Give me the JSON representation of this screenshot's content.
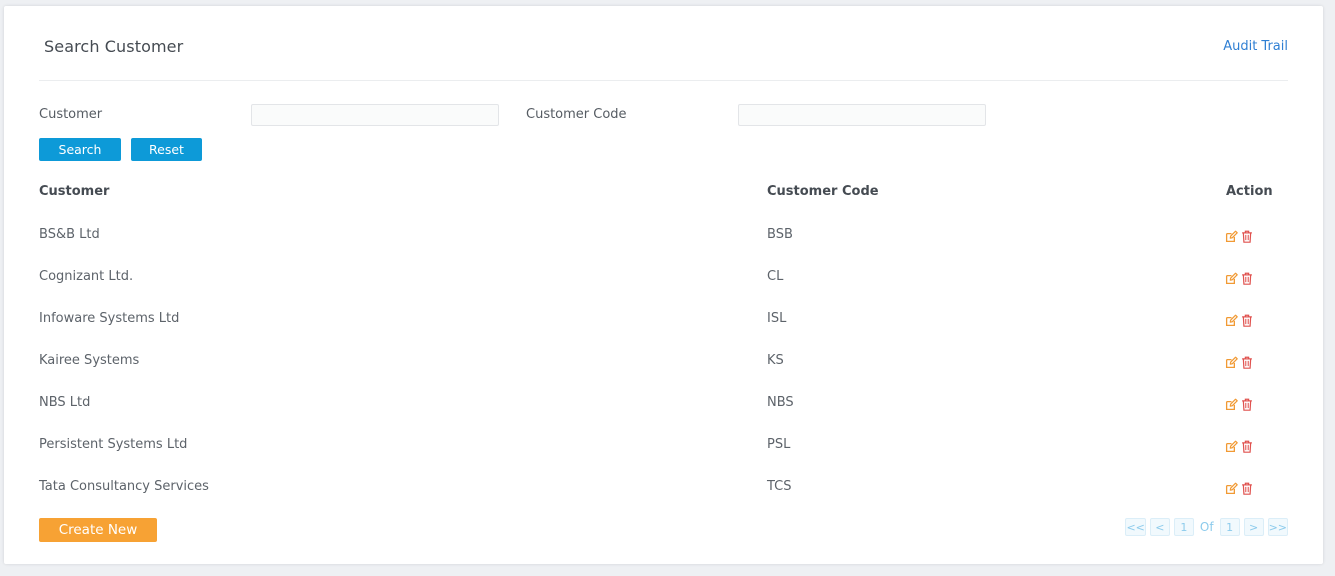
{
  "header": {
    "title": "Search Customer",
    "audit_link": "Audit Trail"
  },
  "filters": {
    "customer_label": "Customer",
    "customer_value": "",
    "code_label": "Customer Code",
    "code_value": "",
    "search_label": "Search",
    "reset_label": "Reset"
  },
  "table": {
    "columns": [
      "Customer",
      "Customer Code",
      "Action"
    ],
    "rows": [
      {
        "name": "BS&B Ltd",
        "code": "BSB"
      },
      {
        "name": "Cognizant Ltd.",
        "code": "CL"
      },
      {
        "name": "Infoware Systems Ltd",
        "code": "ISL"
      },
      {
        "name": "Kairee Systems",
        "code": "KS"
      },
      {
        "name": "NBS Ltd",
        "code": "NBS"
      },
      {
        "name": "Persistent Systems Ltd",
        "code": "PSL"
      },
      {
        "name": "Tata Consultancy Services",
        "code": "TCS"
      }
    ],
    "row_actions": [
      "edit-icon",
      "trash-icon"
    ]
  },
  "footer": {
    "create_label": "Create New",
    "pager": {
      "first": "<<",
      "prev": "<",
      "current": "1",
      "of": "Of",
      "total": "1",
      "next": ">",
      "last": ">>"
    }
  },
  "colors": {
    "primary_button": "#0d9ad8",
    "create_button": "#f7a234",
    "link": "#2f7fd3",
    "edit_icon": "#f19a34",
    "delete_icon": "#e0524f"
  }
}
